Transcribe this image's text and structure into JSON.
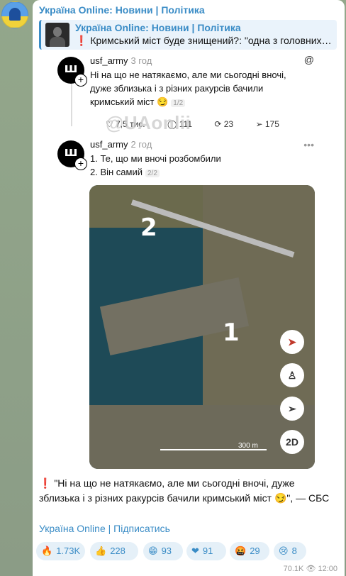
{
  "channel": {
    "title": "Україна Online: Новини | Політика"
  },
  "reply": {
    "title": "Україна Online: Новини | Політика",
    "mark": "❗",
    "text": "Кримський міст буде знищений?: \"одна з головних ..."
  },
  "post1": {
    "username": "usf_army",
    "time": "3 год",
    "text_line1": "Ні на що не натякаємо, але ми сьогодні вночі,",
    "text_line2": "дуже зблизька і з різних ракурсів бачили",
    "text_line3": "кримський міст 😏",
    "counter": "1/2",
    "likes": "7,5 тис.",
    "comments": "111",
    "reposts": "23",
    "shares": "175"
  },
  "watermark": "@UAonlii",
  "post2": {
    "username": "usf_army",
    "time": "2 год",
    "text_line1": "1. Те, що ми вночі розбомбили",
    "text_line2": "2. Він самий",
    "counter": "2/2"
  },
  "map": {
    "label1": "1",
    "label2": "2",
    "btn_2d": "2D",
    "scale": "300 m"
  },
  "caption": {
    "mark": "❗",
    "text": "\"Ні на що не натякаємо, але ми сьогодні вночі, дуже зблизька і з різних ракурсів бачили кримський міст 😏\", — СБС"
  },
  "subscribe_link": "Україна Online | Підписатись",
  "reactions": [
    {
      "emoji": "🔥",
      "count": "1.73K"
    },
    {
      "emoji": "👍",
      "count": "228"
    },
    {
      "emoji": "😁",
      "count": "93"
    },
    {
      "emoji": "❤",
      "count": "91"
    },
    {
      "emoji": "🤬",
      "count": "29"
    },
    {
      "emoji": "😢",
      "count": "8"
    }
  ],
  "views": "70.1K",
  "time": "12:00"
}
